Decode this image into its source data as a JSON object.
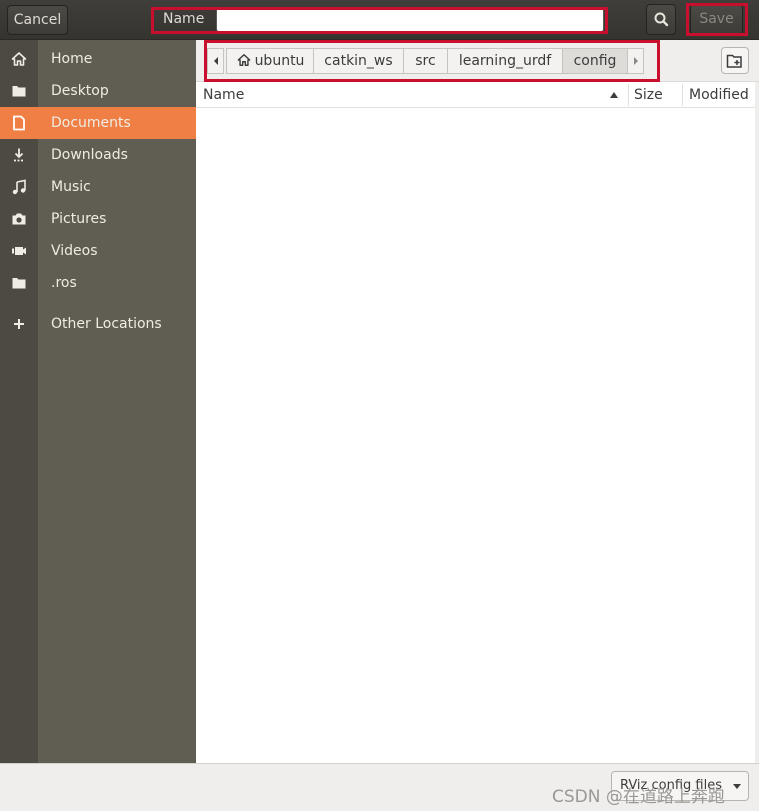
{
  "header": {
    "cancel_label": "Cancel",
    "name_label": "Name",
    "name_value": "",
    "save_label": "Save"
  },
  "sidebar": {
    "items": [
      {
        "label": "Home",
        "icon": "home-icon"
      },
      {
        "label": "Desktop",
        "icon": "folder-icon"
      },
      {
        "label": "Documents",
        "icon": "document-icon",
        "active": true
      },
      {
        "label": "Downloads",
        "icon": "download-icon"
      },
      {
        "label": "Music",
        "icon": "music-icon"
      },
      {
        "label": "Pictures",
        "icon": "camera-icon"
      },
      {
        "label": "Videos",
        "icon": "video-icon"
      },
      {
        "label": ".ros",
        "icon": "folder-icon"
      },
      {
        "label": "Other Locations",
        "icon": "plus-icon"
      }
    ]
  },
  "pathbar": {
    "segments": [
      "ubuntu",
      "catkin_ws",
      "src",
      "learning_urdf",
      "config"
    ],
    "current": "config"
  },
  "file_list": {
    "columns": [
      "Name",
      "Size",
      "Modified"
    ],
    "sort_column": "Name",
    "rows": []
  },
  "footer": {
    "filter_label": "RViz config files",
    "watermark": "CSDN @在道路上奔跑"
  },
  "colors": {
    "accent": "#ef7f45",
    "highlight_box": "#c8102e",
    "sidebar_bg": "#605d52",
    "header_bg": "#3a3935"
  }
}
